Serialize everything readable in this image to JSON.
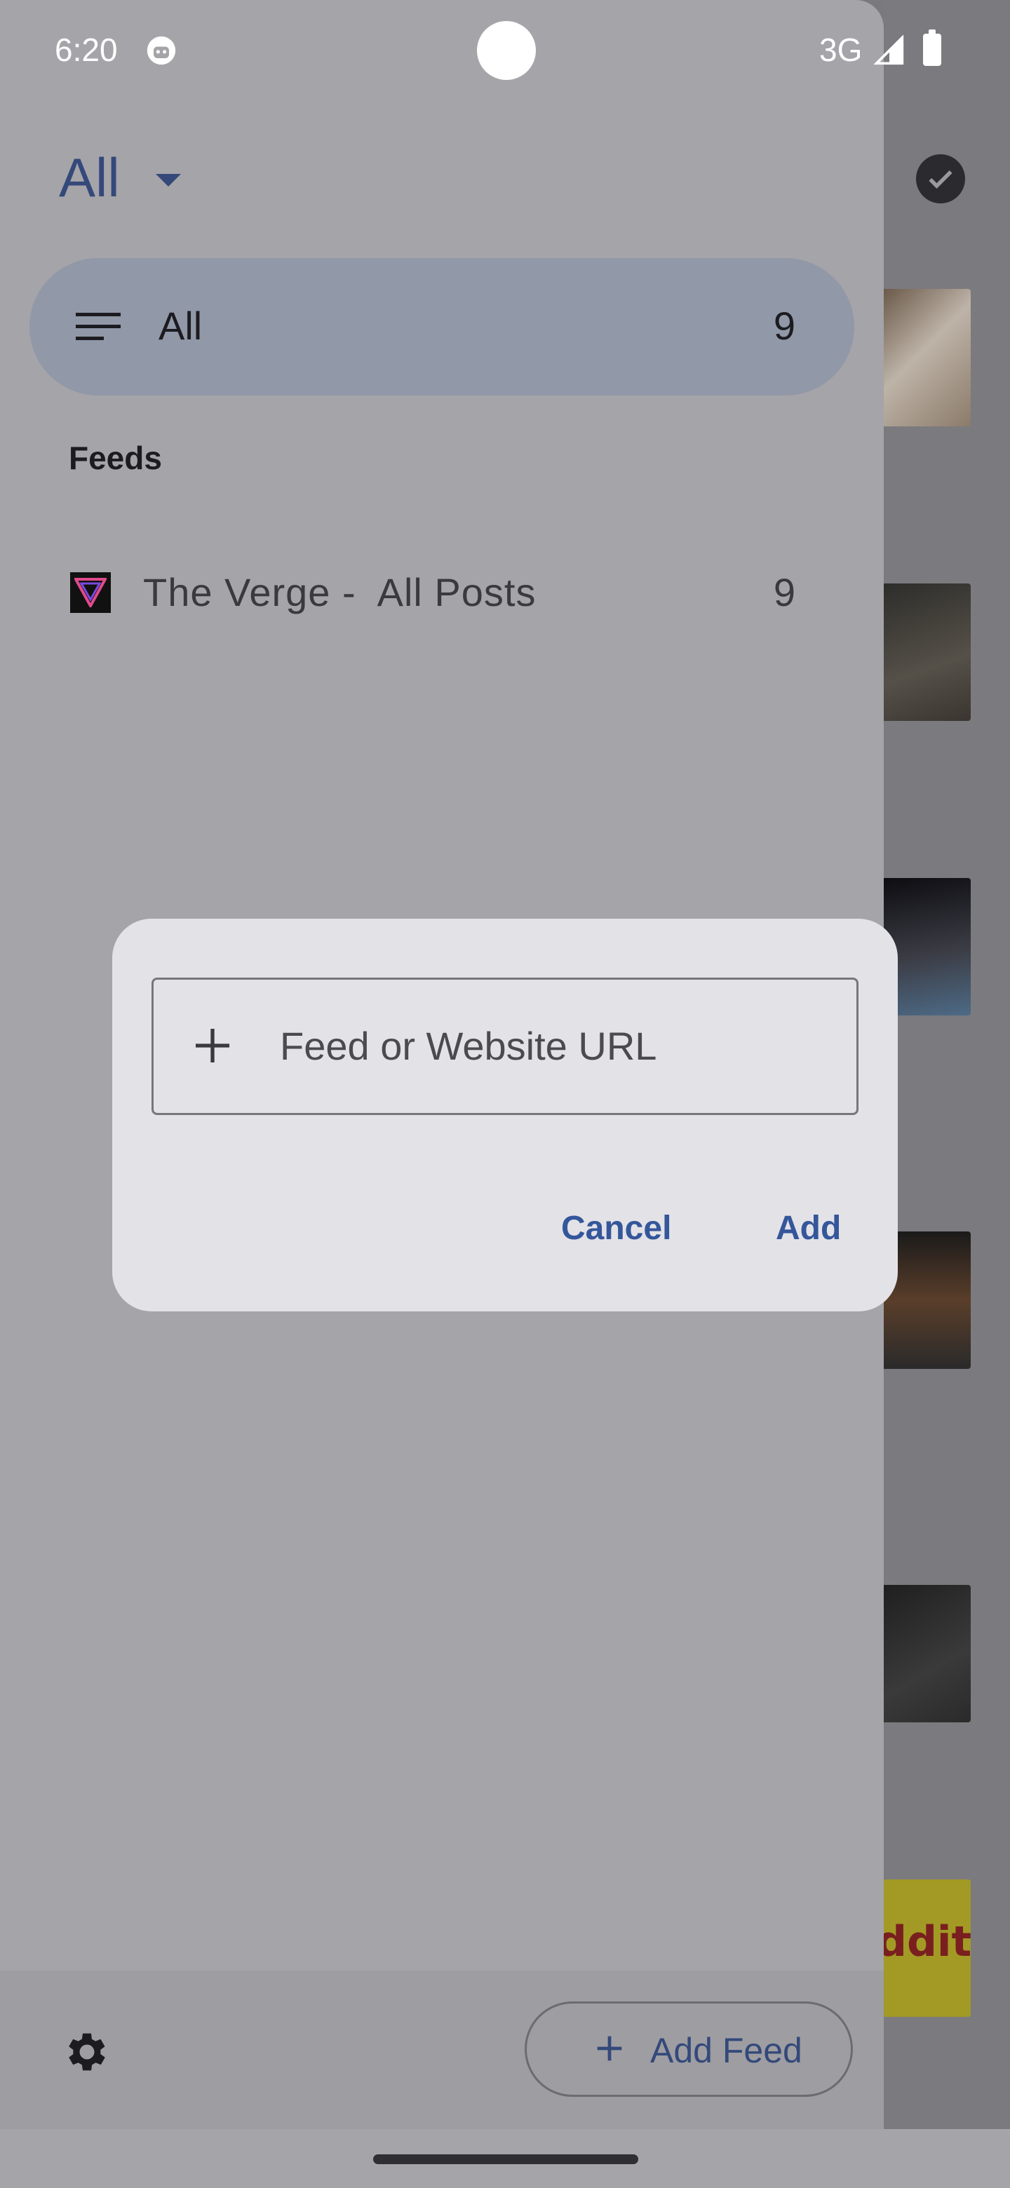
{
  "status_bar": {
    "time": "6:20",
    "network": "3G"
  },
  "drawer": {
    "title": "All",
    "nav": {
      "label": "All",
      "count": "9"
    },
    "section_label": "Feeds",
    "feeds": [
      {
        "label": "The Verge -  All Posts",
        "count": "9"
      }
    ],
    "add_feed_label": "Add Feed"
  },
  "dialog": {
    "input_placeholder": "Feed or Website URL",
    "cancel_label": "Cancel",
    "add_label": "Add"
  },
  "colors": {
    "accent": "#34497a",
    "dialog_bg": "#e3e2e7",
    "drawer_bg": "#a5a4a8",
    "selected_nav": "#9198a8"
  }
}
